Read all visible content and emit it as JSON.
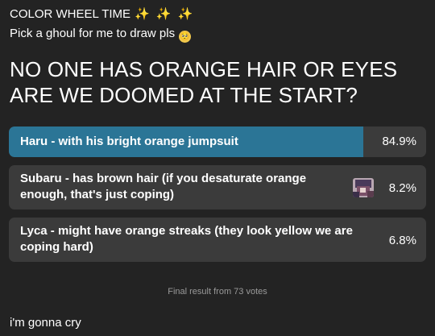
{
  "post": {
    "title": "COLOR WHEEL TIME",
    "title_emoji": "✨ ✨ ✨",
    "subtitle": "Pick a ghoul for me to draw pls",
    "subtitle_emoji": "🥺",
    "caption": "i'm gonna cry"
  },
  "poll": {
    "question": "NO ONE HAS ORANGE HAIR OR EYES ARE WE DOOMED AT THE START?",
    "options": [
      {
        "label": "Haru - with his bright orange jumpsuit",
        "percent": "84.9%",
        "fraction": 0.849,
        "selected": true
      },
      {
        "label": "Subaru - has brown hair (if you desaturate orange enough, that's just coping)",
        "percent": "8.2%",
        "fraction": 0.082,
        "has_avatar": true
      },
      {
        "label": "Lyca - might have orange streaks (they look yellow we are coping hard)",
        "percent": "6.8%",
        "fraction": 0.068
      }
    ],
    "result_text": "Final result from 73 votes"
  },
  "colors": {
    "background": "#232323",
    "option_bg": "#3b3b3b",
    "winner_fill": "#2b7596",
    "muted_text": "#9a9a9a"
  }
}
